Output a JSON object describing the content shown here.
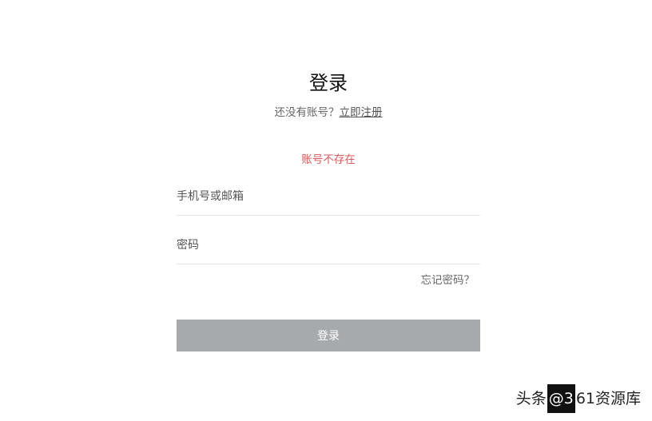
{
  "login": {
    "title": "登录",
    "no_account_prompt": "还没有账号？",
    "register_link": "立即注册",
    "error_message": "账号不存在",
    "account_placeholder": "手机号或邮箱",
    "password_placeholder": "密码",
    "forgot_password": "忘记密码？",
    "submit_label": "登录"
  },
  "watermark": {
    "prefix": "头条",
    "at": "@",
    "boxed": "3",
    "suffix": "61资源库"
  }
}
